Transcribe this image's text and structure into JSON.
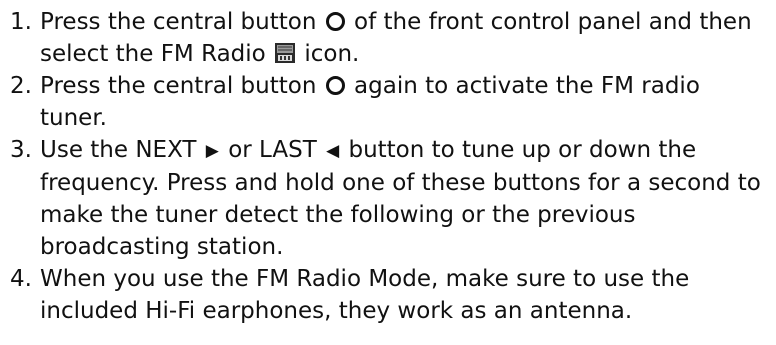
{
  "steps": [
    {
      "number": "1.",
      "parts": [
        "Press the central button",
        "of the front control panel and then select the FM Radio",
        "icon."
      ],
      "icons": [
        "central-button-icon",
        "fm-radio-icon"
      ]
    },
    {
      "number": "2.",
      "parts": [
        "Press the central button",
        "again to activate the FM radio tuner."
      ],
      "icons": [
        "central-button-icon"
      ]
    },
    {
      "number": "3.",
      "parts": [
        "Use the NEXT",
        "or LAST",
        "button to tune up or down the frequency. Press and hold one of these buttons for a second to make the tuner detect the following or the previous broadcasting station."
      ],
      "icons": [
        "next-triangle-icon",
        "last-triangle-icon"
      ],
      "glyphs": {
        "next": "▶",
        "last": "◀"
      }
    },
    {
      "number": "4.",
      "parts": [
        "When you use the FM Radio Mode, make sure to use the included Hi-Fi earphones, they work as an antenna."
      ]
    }
  ]
}
